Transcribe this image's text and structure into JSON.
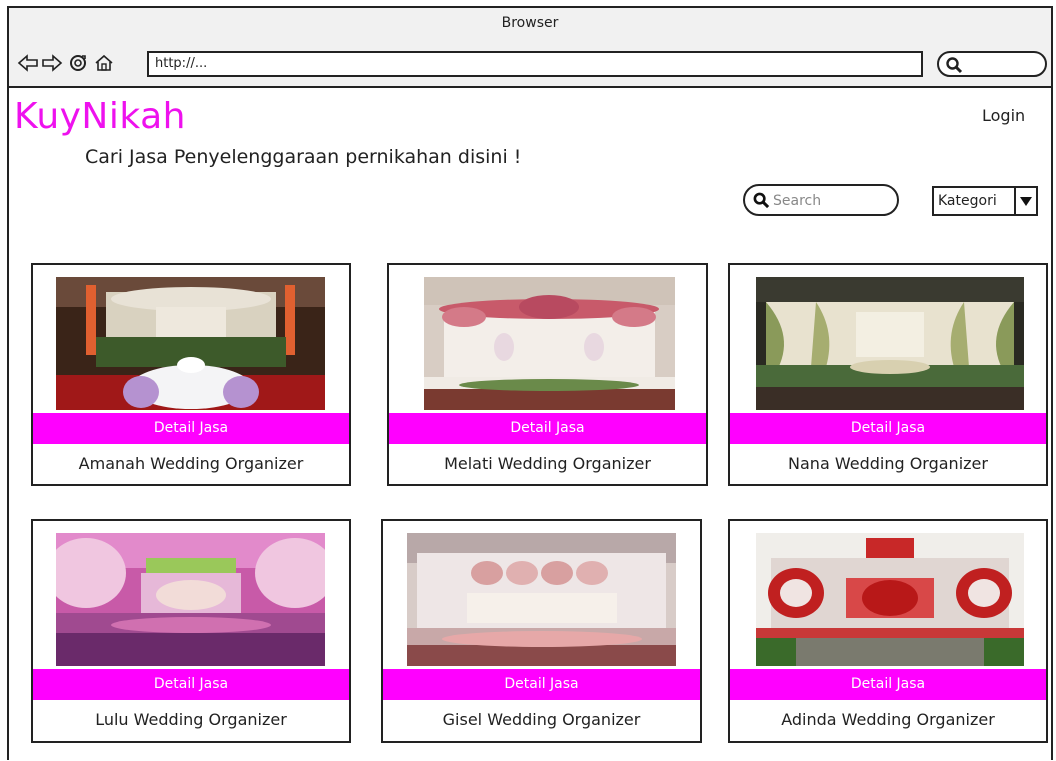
{
  "browser": {
    "title": "Browser",
    "url": "http://...",
    "icons": [
      "back-arrow-icon",
      "forward-arrow-icon",
      "reload-icon",
      "home-icon",
      "search-icon"
    ]
  },
  "header": {
    "brand": "KuyNikah",
    "tagline": "Cari Jasa Penyelenggaraan pernikahan disini !",
    "login_label": "Login"
  },
  "search": {
    "placeholder": "Search"
  },
  "category": {
    "selected": "Kategori"
  },
  "colors": {
    "accent": "#ff00ff",
    "brand": "#ee11ee"
  },
  "cards": [
    {
      "detail_label": "Detail Jasa",
      "name": "Amanah Wedding Organizer"
    },
    {
      "detail_label": "Detail Jasa",
      "name": "Melati Wedding Organizer"
    },
    {
      "detail_label": "Detail Jasa",
      "name": "Nana Wedding Organizer"
    },
    {
      "detail_label": "Detail Jasa",
      "name": "Lulu Wedding Organizer"
    },
    {
      "detail_label": "Detail Jasa",
      "name": "Gisel Wedding Organizer"
    },
    {
      "detail_label": "Detail Jasa",
      "name": "Adinda Wedding Organizer"
    }
  ]
}
